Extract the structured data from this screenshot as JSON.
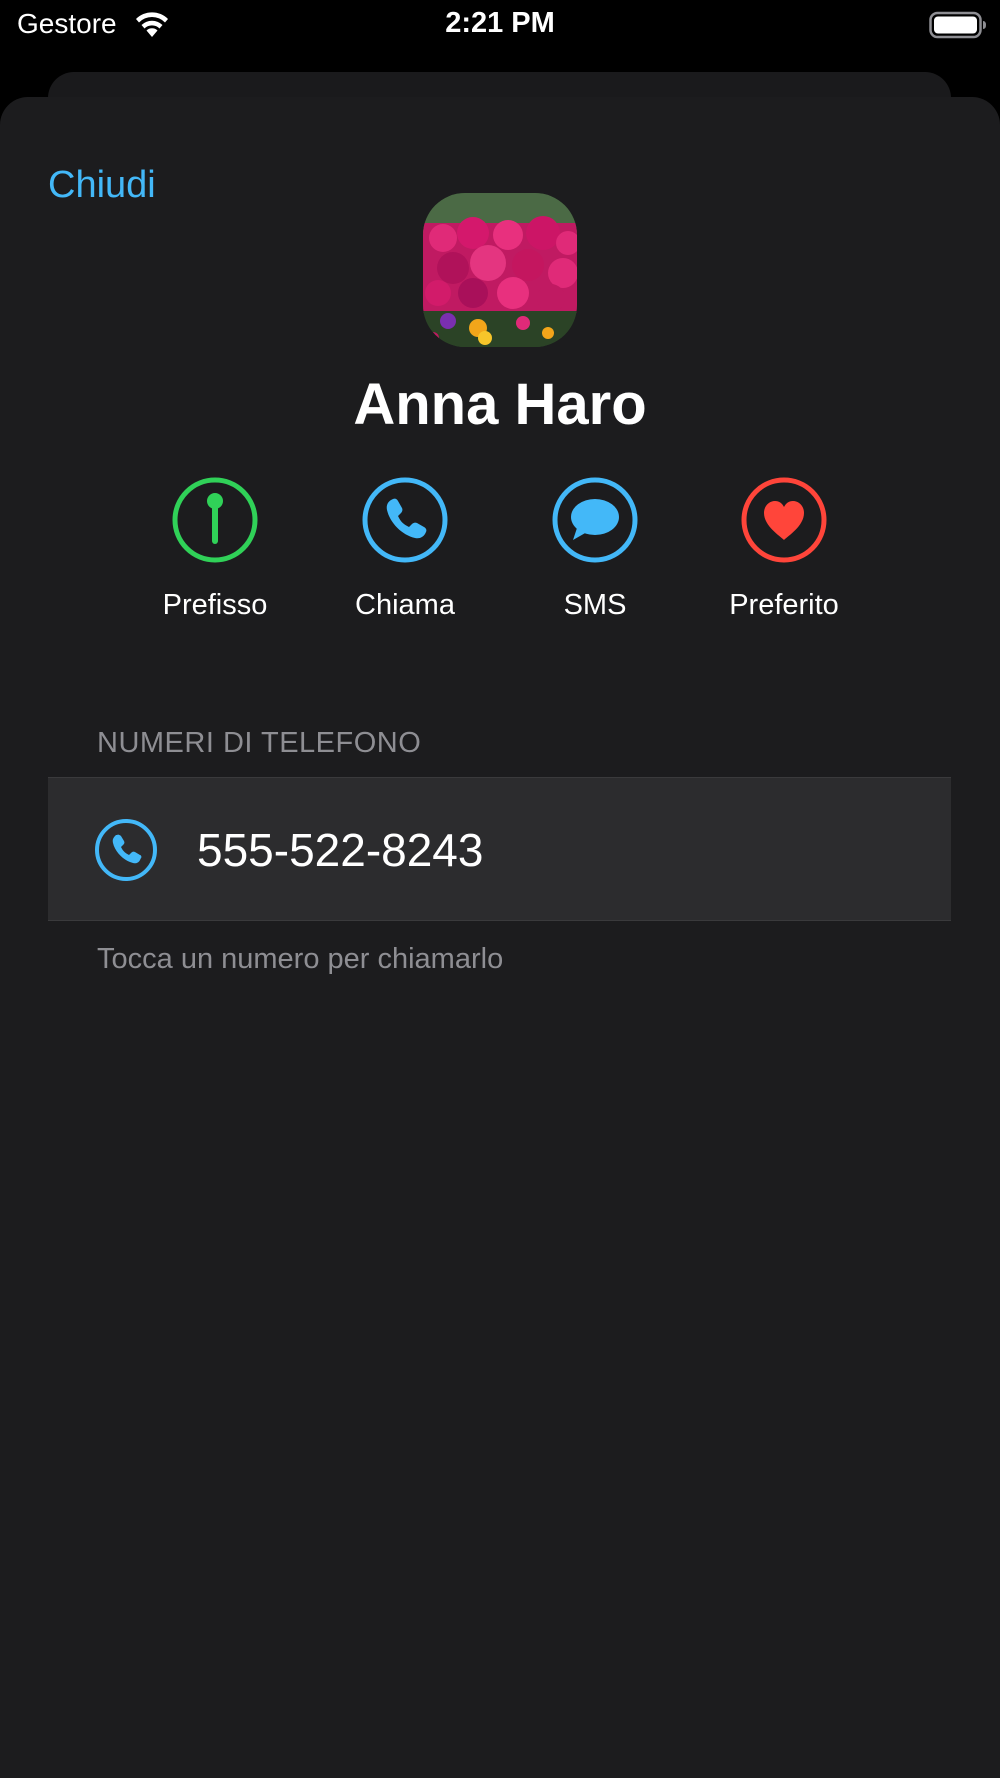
{
  "status_bar": {
    "carrier": "Gestore",
    "time": "2:21 PM",
    "icons": [
      "wifi-icon",
      "battery-icon"
    ]
  },
  "nav": {
    "close_label": "Chiudi"
  },
  "contact": {
    "name": "Anna Haro",
    "avatar": "flower-photo-avatar"
  },
  "actions": [
    {
      "label": "Prefisso",
      "icon": "pin-icon",
      "color": "#30d158"
    },
    {
      "label": "Chiama",
      "icon": "phone-icon",
      "color": "#43b8f8"
    },
    {
      "label": "SMS",
      "icon": "message-bubble-icon",
      "color": "#43b8f8"
    },
    {
      "label": "Preferito",
      "icon": "heart-icon",
      "color": "#ff453a"
    }
  ],
  "phones": {
    "header": "NUMERI DI TELEFONO",
    "items": [
      {
        "number": "555-522-8243",
        "icon": "phone-icon"
      }
    ],
    "footer": "Tocca un numero per chiamarlo"
  },
  "colors": {
    "accent_blue": "#43b8f8",
    "green": "#30d158",
    "red": "#ff453a",
    "sheet_background": "#1c1c1e",
    "row_background": "#2c2c2e",
    "secondary_text": "#8e8e93"
  }
}
